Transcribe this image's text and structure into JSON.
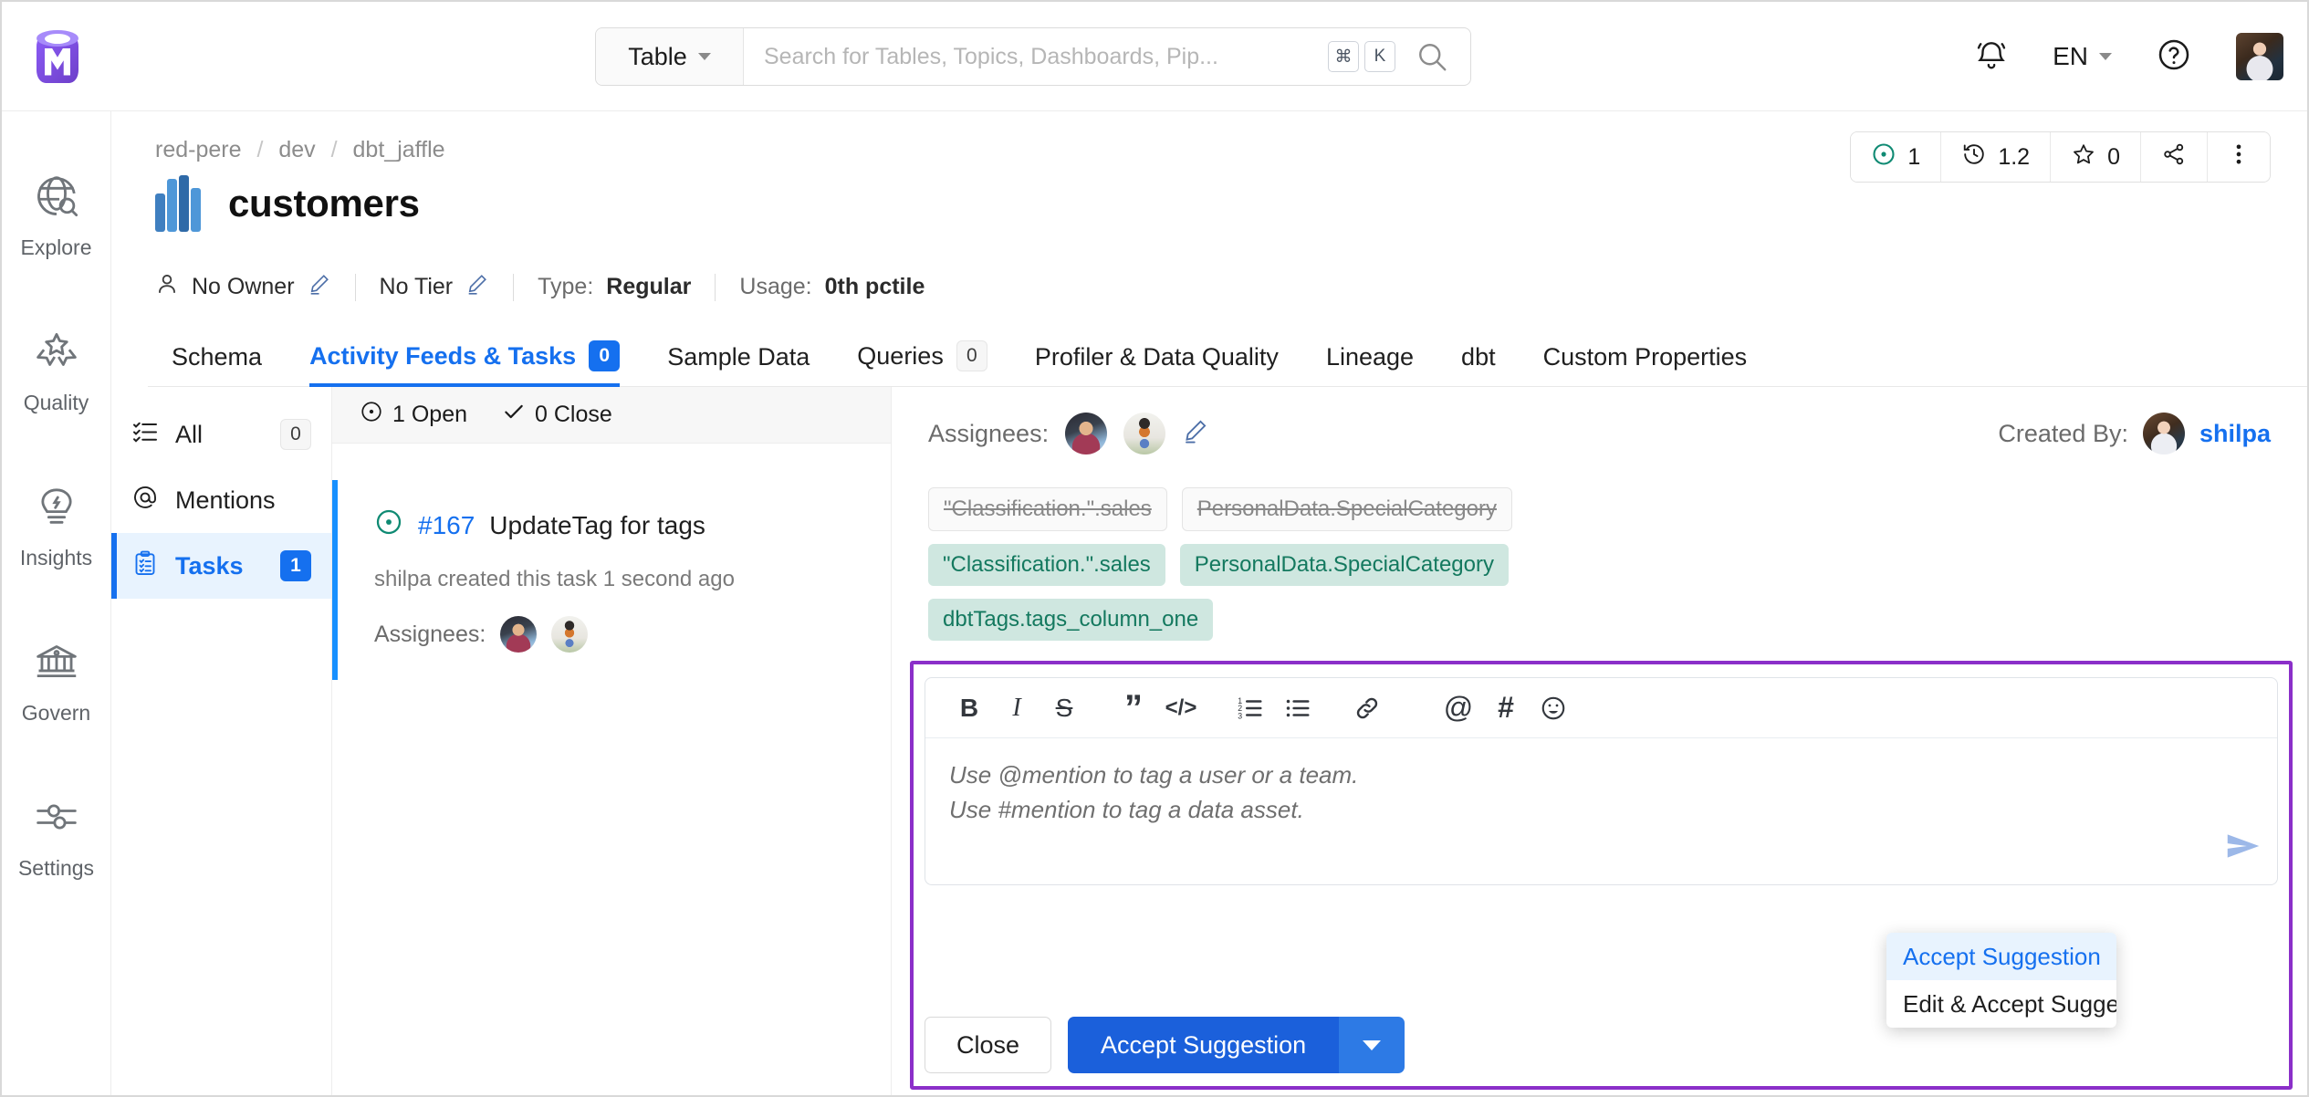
{
  "header": {
    "logo_icon": "openmetadata-logo",
    "search": {
      "scope_label": "Table",
      "placeholder": "Search for Tables, Topics, Dashboards, Pip...",
      "value": "",
      "shortcut_cmd": "⌘",
      "shortcut_key": "K",
      "search_icon": "search-icon"
    },
    "notifications_icon": "bell-icon",
    "language": "EN",
    "help_icon": "question-circle-icon",
    "avatar": "user-avatar"
  },
  "sidebar": {
    "items": [
      {
        "label": "Explore",
        "icon": "globe-search-icon"
      },
      {
        "label": "Quality",
        "icon": "award-ribbon-icon"
      },
      {
        "label": "Insights",
        "icon": "lightbulb-icon"
      },
      {
        "label": "Govern",
        "icon": "bank-icon"
      },
      {
        "label": "Settings",
        "icon": "sliders-icon"
      }
    ]
  },
  "entity": {
    "breadcrumb": [
      "red-pere",
      "dev",
      "dbt_jaffle"
    ],
    "title": "customers",
    "icon": "table-columns-icon",
    "owner_label": "No Owner",
    "tier_label": "No Tier",
    "type_prefix": "Type:",
    "type_value": "Regular",
    "usage_prefix": "Usage:",
    "usage_value": "0th pctile"
  },
  "header_actions": {
    "announcement_count": "1",
    "version": "1.2",
    "votes": "0",
    "share_icon": "share-icon",
    "more_icon": "more-vertical-icon"
  },
  "tabs": [
    {
      "label": "Schema",
      "badge": null,
      "active": false
    },
    {
      "label": "Activity Feeds & Tasks",
      "badge": "0",
      "active": true
    },
    {
      "label": "Sample Data",
      "badge": null,
      "active": false
    },
    {
      "label": "Queries",
      "badge": "0",
      "active": false
    },
    {
      "label": "Profiler & Data Quality",
      "badge": null,
      "active": false
    },
    {
      "label": "Lineage",
      "badge": null,
      "active": false
    },
    {
      "label": "dbt",
      "badge": null,
      "active": false
    },
    {
      "label": "Custom Properties",
      "badge": null,
      "active": false
    }
  ],
  "feed_nav": [
    {
      "label": "All",
      "badge": "0",
      "icon": "checklist-icon",
      "active": false
    },
    {
      "label": "Mentions",
      "badge": null,
      "icon": "at-icon",
      "active": false
    },
    {
      "label": "Tasks",
      "badge": "1",
      "icon": "clipboard-task-icon",
      "active": true
    }
  ],
  "feed": {
    "open_count": "1 Open",
    "close_count": "0 Close",
    "task": {
      "id": "#167",
      "title": "UpdateTag for tags",
      "subtitle": "shilpa created this task 1 second ago",
      "assignees_label": "Assignees:"
    }
  },
  "detail": {
    "assignees_label": "Assignees:",
    "edit_icon": "pencil-icon",
    "created_by_label": "Created By:",
    "created_by_user": "shilpa",
    "old_tags": [
      "\"Classification.\".sales",
      "PersonalData.SpecialCategory"
    ],
    "new_tags": [
      "\"Classification.\".sales",
      "PersonalData.SpecialCategory",
      "dbtTags.tags_column_one"
    ],
    "editor": {
      "toolbar": [
        {
          "label": "B",
          "name": "bold-icon"
        },
        {
          "label": "I",
          "name": "italic-icon"
        },
        {
          "label": "S",
          "name": "strikethrough-icon"
        },
        {
          "label": "”",
          "name": "blockquote-icon"
        },
        {
          "label": "</>",
          "name": "code-icon"
        },
        {
          "label": "1≡",
          "name": "ordered-list-icon"
        },
        {
          "label": "≡",
          "name": "bullet-list-icon"
        },
        {
          "label": "🔗",
          "name": "link-icon"
        },
        {
          "label": "@",
          "name": "mention-icon"
        },
        {
          "label": "#",
          "name": "hashtag-icon"
        },
        {
          "label": "☺",
          "name": "emoji-icon"
        }
      ],
      "placeholder_line1": "Use @mention to tag a user or a team.",
      "placeholder_line2": "Use #mention to tag a data asset.",
      "send_icon": "send-icon"
    },
    "suggestion_menu": [
      {
        "label": "Accept Suggestion",
        "selected": true
      },
      {
        "label": "Edit & Accept Suggestion",
        "selected": false
      }
    ],
    "close_button": "Close",
    "accept_button": "Accept Suggestion",
    "accept_caret_icon": "chevron-down-icon"
  },
  "colors": {
    "accent_blue": "#1570ef",
    "primary_button": "#1b60db",
    "tag_green_bg": "#cfe7e0",
    "tag_green_text": "#14795f",
    "highlight_purple": "#8b2fc9",
    "teal": "#0f8a73"
  }
}
